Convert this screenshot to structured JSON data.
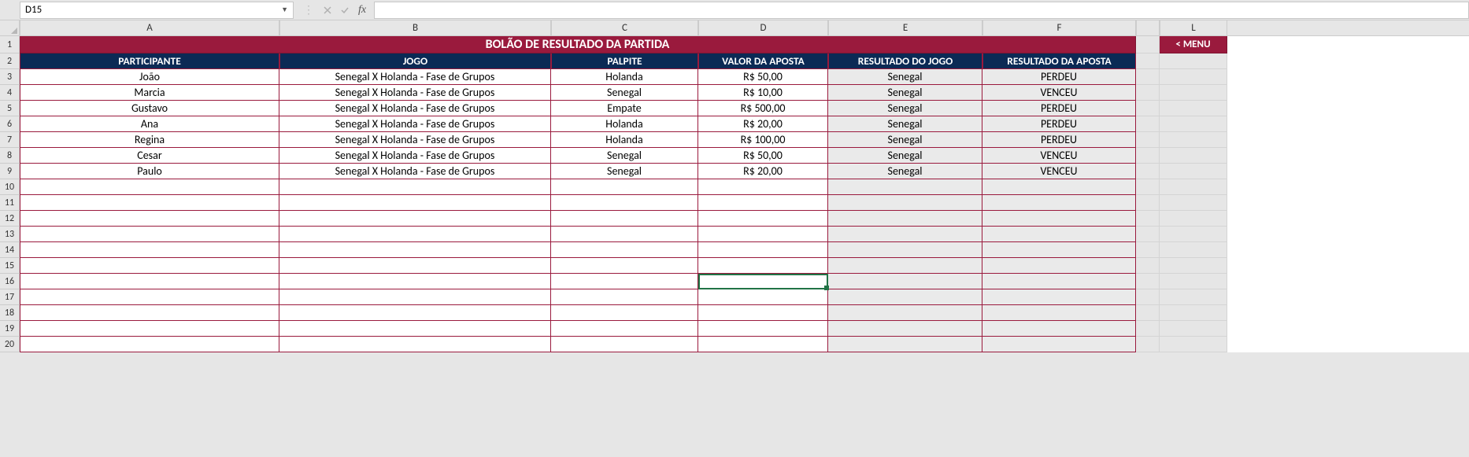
{
  "formula_bar": {
    "name_box": "D15",
    "fx_label": "fx",
    "formula_value": ""
  },
  "menu_button": "< MENU",
  "title": "BOLÃO DE RESULTADO DA PARTIDA",
  "columns": [
    "A",
    "B",
    "C",
    "D",
    "E",
    "F",
    "L"
  ],
  "headers": {
    "participante": "PARTICIPANTE",
    "jogo": "JOGO",
    "palpite": "PALPITE",
    "valor": "VALOR DA APOSTA",
    "resultado_jogo": "RESULTADO DO JOGO",
    "resultado_aposta": "RESULTADO DA APOSTA"
  },
  "rows": [
    {
      "participante": "João",
      "jogo": "Senegal X Holanda - Fase de Grupos",
      "palpite": "Holanda",
      "valor": "R$ 50,00",
      "resultado_jogo": "Senegal",
      "resultado_aposta": "PERDEU"
    },
    {
      "participante": "Marcia",
      "jogo": "Senegal X Holanda - Fase de Grupos",
      "palpite": "Senegal",
      "valor": "R$ 10,00",
      "resultado_jogo": "Senegal",
      "resultado_aposta": "VENCEU"
    },
    {
      "participante": "Gustavo",
      "jogo": "Senegal X Holanda - Fase de Grupos",
      "palpite": "Empate",
      "valor": "R$ 500,00",
      "resultado_jogo": "Senegal",
      "resultado_aposta": "PERDEU"
    },
    {
      "participante": "Ana",
      "jogo": "Senegal X Holanda - Fase de Grupos",
      "palpite": "Holanda",
      "valor": "R$ 20,00",
      "resultado_jogo": "Senegal",
      "resultado_aposta": "PERDEU"
    },
    {
      "participante": "Regina",
      "jogo": "Senegal X Holanda - Fase de Grupos",
      "palpite": "Holanda",
      "valor": "R$ 100,00",
      "resultado_jogo": "Senegal",
      "resultado_aposta": "PERDEU"
    },
    {
      "participante": "Cesar",
      "jogo": "Senegal X Holanda - Fase de Grupos",
      "palpite": "Senegal",
      "valor": "R$ 50,00",
      "resultado_jogo": "Senegal",
      "resultado_aposta": "VENCEU"
    },
    {
      "participante": "Paulo",
      "jogo": "Senegal X Holanda - Fase de Grupos",
      "palpite": "Senegal",
      "valor": "R$ 20,00",
      "resultado_jogo": "Senegal",
      "resultado_aposta": "VENCEU"
    },
    {
      "participante": "",
      "jogo": "",
      "palpite": "",
      "valor": "",
      "resultado_jogo": "",
      "resultado_aposta": ""
    },
    {
      "participante": "",
      "jogo": "",
      "palpite": "",
      "valor": "",
      "resultado_jogo": "",
      "resultado_aposta": ""
    },
    {
      "participante": "",
      "jogo": "",
      "palpite": "",
      "valor": "",
      "resultado_jogo": "",
      "resultado_aposta": ""
    },
    {
      "participante": "",
      "jogo": "",
      "palpite": "",
      "valor": "",
      "resultado_jogo": "",
      "resultado_aposta": ""
    },
    {
      "participante": "",
      "jogo": "",
      "palpite": "",
      "valor": "",
      "resultado_jogo": "",
      "resultado_aposta": ""
    },
    {
      "participante": "",
      "jogo": "",
      "palpite": "",
      "valor": "",
      "resultado_jogo": "",
      "resultado_aposta": ""
    },
    {
      "participante": "",
      "jogo": "",
      "palpite": "",
      "valor": "",
      "resultado_jogo": "",
      "resultado_aposta": ""
    },
    {
      "participante": "",
      "jogo": "",
      "palpite": "",
      "valor": "",
      "resultado_jogo": "",
      "resultado_aposta": ""
    },
    {
      "participante": "",
      "jogo": "",
      "palpite": "",
      "valor": "",
      "resultado_jogo": "",
      "resultado_aposta": ""
    },
    {
      "participante": "",
      "jogo": "",
      "palpite": "",
      "valor": "",
      "resultado_jogo": "",
      "resultado_aposta": ""
    },
    {
      "participante": "",
      "jogo": "",
      "palpite": "",
      "valor": "",
      "resultado_jogo": "",
      "resultado_aposta": ""
    }
  ],
  "active_cell": "D15"
}
